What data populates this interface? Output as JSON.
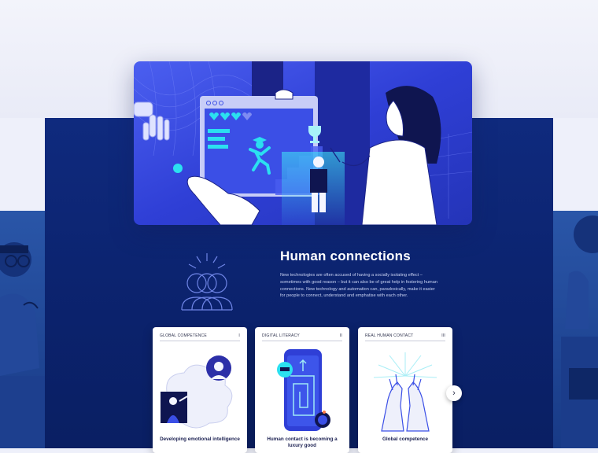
{
  "section": {
    "title": "Human connections",
    "intro": "New technologies are often accused of having a socially isolating effect – sometimes with good reason – but it can also be of great help in fostering human connections. New technology and automation can, paradoxically, make it easier for people to connect, understand and emphatise with each other."
  },
  "cards": [
    {
      "category": "GLOBAL COMPETENCE",
      "number": "I",
      "title": "Developing emotional intelligence",
      "icon": "people-bubble-illustration"
    },
    {
      "category": "DIGITAL LITERACY",
      "number": "II",
      "title": "Human contact is becoming a luxury good",
      "icon": "phone-maze-illustration"
    },
    {
      "category": "REAL HUMAN CONTACT",
      "number": "III",
      "title": "Global competence",
      "icon": "hands-touch-illustration"
    }
  ],
  "next_button": {
    "icon": "chevron-right-icon",
    "glyph": "›"
  },
  "colors": {
    "panel": "#0f2a7e",
    "accent": "#3d4fe0",
    "highlight": "#2be0f0",
    "card": "#ffffff"
  }
}
